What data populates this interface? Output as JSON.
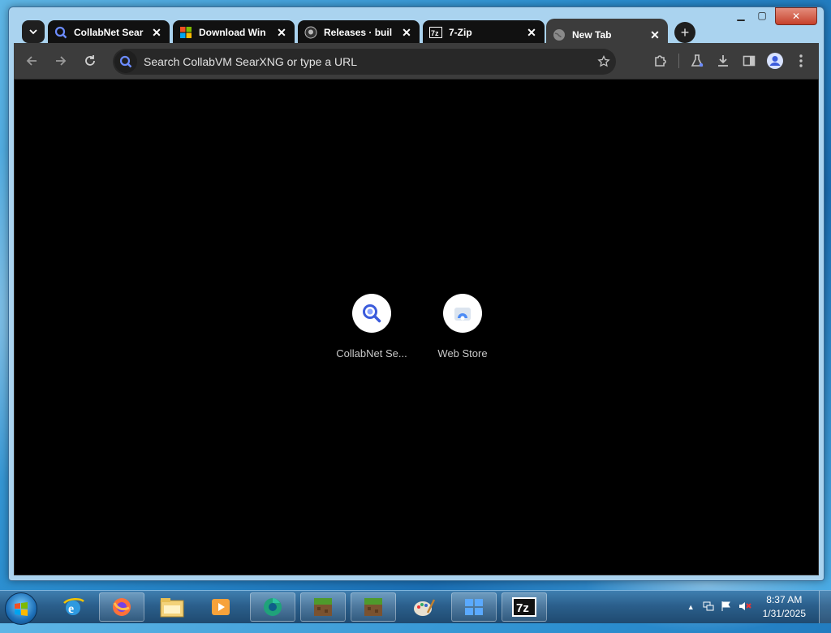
{
  "browser": {
    "tabs": [
      {
        "title": "CollabNet Sear",
        "icon": "searxng-icon",
        "active": false
      },
      {
        "title": "Download Win",
        "icon": "microsoft-icon",
        "active": false
      },
      {
        "title": "Releases · buil",
        "icon": "github-icon",
        "active": false
      },
      {
        "title": "7-Zip",
        "icon": "7zip-icon",
        "active": false
      },
      {
        "title": "New Tab",
        "icon": "globe-icon",
        "active": true
      }
    ],
    "omnibox_placeholder": "Search CollabVM SearXNG or type a URL"
  },
  "newtab": {
    "shortcuts": [
      {
        "label": "CollabNet Se...",
        "icon": "searxng-icon"
      },
      {
        "label": "Web Store",
        "icon": "web-store-icon"
      }
    ]
  },
  "taskbar": {
    "pinned": [
      "internet-explorer-icon",
      "firefox-icon",
      "file-explorer-icon",
      "media-player-icon",
      "chrome-like-icon",
      "minecraft-icon",
      "minecraft-icon",
      "paint-icon",
      "windows-tiles-icon",
      "7zip-icon"
    ],
    "clock_time": "8:37 AM",
    "clock_date": "1/31/2025"
  },
  "colors": {
    "accent": "#5b7cff",
    "page_bg": "#000000",
    "toolbar": "#3c3c3c"
  }
}
